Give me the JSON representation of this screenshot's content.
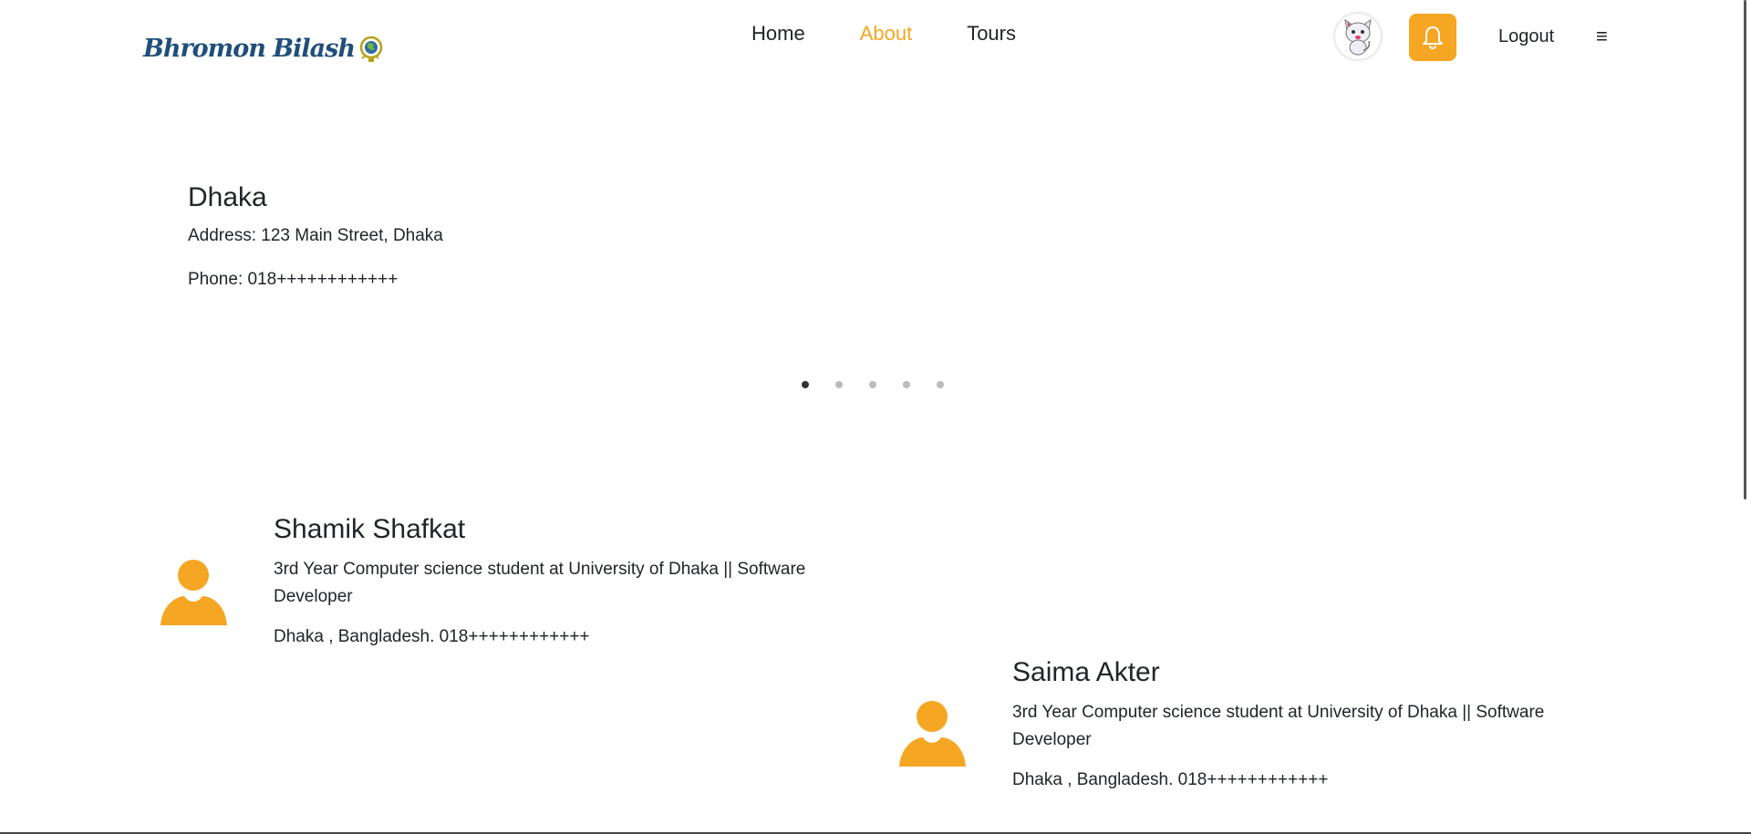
{
  "brand": {
    "logo_text": "Bhromon Bilash",
    "accent": "#f5a623"
  },
  "nav": {
    "links": [
      {
        "label": "Home"
      },
      {
        "label": "About"
      },
      {
        "label": "Tours"
      }
    ],
    "active_link": "About",
    "logout_label": "Logout",
    "menu_icon": "≡"
  },
  "slider": {
    "title": "Dhaka",
    "address": "Address: 123 Main Street, Dhaka",
    "phone": "Phone: 018++++++++++++",
    "dot_count": 5,
    "active_dot": 1
  },
  "members": [
    {
      "name": "Shamik Shafkat",
      "role": "3rd Year Computer science student at University of Dhaka || Software Developer",
      "contact": "Dhaka , Bangladesh. 018++++++++++++"
    },
    {
      "name": "Saima Akter",
      "role": "3rd Year Computer science student at University of Dhaka || Software Developer",
      "contact": "Dhaka , Bangladesh. 018++++++++++++"
    }
  ]
}
